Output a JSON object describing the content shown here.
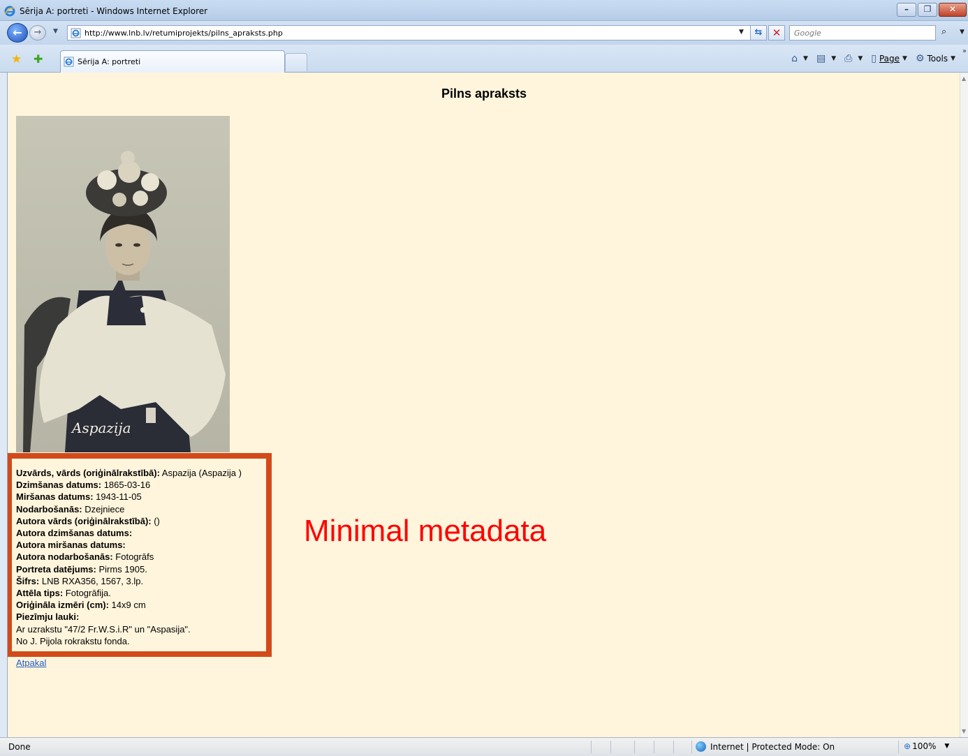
{
  "window": {
    "title": "Sērija A: portreti - Windows Internet Explorer",
    "controls": {
      "minimize": "–",
      "maximize": "❐",
      "close": "✕"
    }
  },
  "address_bar": {
    "url": "http://www.lnb.lv/retumiprojekts/pilns_apraksts.php",
    "search_placeholder": "Google"
  },
  "tabs": [
    {
      "label": "Sērija A: portreti",
      "active": true
    }
  ],
  "command_bar": {
    "page_label": "Page",
    "tools_label": "Tools"
  },
  "content": {
    "heading": "Pilns apraksts",
    "portrait_signature": "Aspazija",
    "metadata": [
      {
        "key": "Uzvārds, vārds (oriģinālrakstībā):",
        "value": " Aspazija (Aspazija )"
      },
      {
        "key": "Dzimšanas datums:",
        "value": " 1865-03-16"
      },
      {
        "key": "Miršanas datums:",
        "value": " 1943-11-05"
      },
      {
        "key": "Nodarbošanās:",
        "value": " Dzejniece"
      },
      {
        "key": "Autora vārds (oriģinālrakstībā):",
        "value": " ()"
      },
      {
        "key": "Autora dzimšanas datums:",
        "value": ""
      },
      {
        "key": "Autora miršanas datums:",
        "value": ""
      },
      {
        "key": "Autora nodarbošanās:",
        "value": " Fotogrāfs"
      },
      {
        "key": "Portreta datējums:",
        "value": " Pirms 1905."
      },
      {
        "key": "Šifrs:",
        "value": " LNB RXA356, 1567, 3.lp."
      },
      {
        "key": "Attēla tips:",
        "value": " Fotogrāfija."
      },
      {
        "key": "Oriģināla izmēri (cm):",
        "value": " 14x9 cm"
      },
      {
        "key": "Piezīmju lauki:",
        "value": ""
      }
    ],
    "notes": [
      "Ar uzrakstu \"47/2 Fr.W.S.i.R\" un \"Aspasija\".",
      "No J. Pijola rokrakstu fonda."
    ],
    "back_link": "Atpakal",
    "annotation": "Minimal metadata"
  },
  "status_bar": {
    "status": "Done",
    "zone": "Internet | Protected Mode: On",
    "zoom": "100%"
  },
  "colors": {
    "page_background": "#fff5dc",
    "highlight_border": "#d24a1a",
    "annotation_text": "#ff0000",
    "link": "#1f5cc7"
  }
}
